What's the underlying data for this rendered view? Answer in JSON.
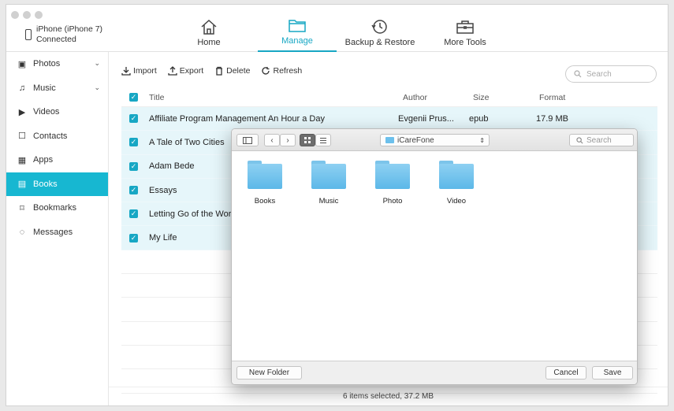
{
  "device": {
    "name": "iPhone (iPhone 7)",
    "status": "Connected"
  },
  "nav": [
    {
      "label": "Home",
      "icon": "home-icon"
    },
    {
      "label": "Manage",
      "icon": "folder-icon",
      "active": true
    },
    {
      "label": "Backup & Restore",
      "icon": "restore-icon"
    },
    {
      "label": "More Tools",
      "icon": "toolbox-icon"
    }
  ],
  "sidebar": {
    "items": [
      {
        "label": "Photos",
        "icon": "photos-icon"
      },
      {
        "label": "Music",
        "icon": "music-icon"
      },
      {
        "label": "Videos",
        "icon": "videos-icon"
      },
      {
        "label": "Contacts",
        "icon": "contacts-icon"
      },
      {
        "label": "Apps",
        "icon": "apps-icon"
      },
      {
        "label": "Books",
        "icon": "books-icon",
        "active": true
      },
      {
        "label": "Bookmarks",
        "icon": "bookmark-icon"
      },
      {
        "label": "Messages",
        "icon": "messages-icon"
      }
    ]
  },
  "toolbar": {
    "import": "Import",
    "export": "Export",
    "delete": "Delete",
    "refresh": "Refresh",
    "search_placeholder": "Search"
  },
  "table": {
    "headers": {
      "title": "Title",
      "author": "Author",
      "size": "Size",
      "format": "Format"
    },
    "rows": [
      {
        "title": "Affiliate Program Management An Hour a Day",
        "author": "Evgenii Prus...",
        "size": "epub",
        "format": "17.9 MB"
      },
      {
        "title": "A Tale of Two Cities",
        "author": "",
        "size": "",
        "format": ""
      },
      {
        "title": "Adam Bede",
        "author": "",
        "size": "",
        "format": ""
      },
      {
        "title": "Essays",
        "author": "",
        "size": "",
        "format": ""
      },
      {
        "title": "Letting Go of the Worl",
        "author": "",
        "size": "",
        "format": ""
      },
      {
        "title": "My Life",
        "author": "",
        "size": "",
        "format": ""
      }
    ]
  },
  "status": "6 items selected, 37.2 MB",
  "dialog": {
    "location": "iCareFone",
    "search_placeholder": "Search",
    "folders": [
      "Books",
      "Music",
      "Photo",
      "Video"
    ],
    "new_folder": "New Folder",
    "cancel": "Cancel",
    "save": "Save"
  },
  "colors": {
    "accent": "#17a7c4",
    "selected_row": "#e6f6fa",
    "folder": "#6cc0ec"
  }
}
